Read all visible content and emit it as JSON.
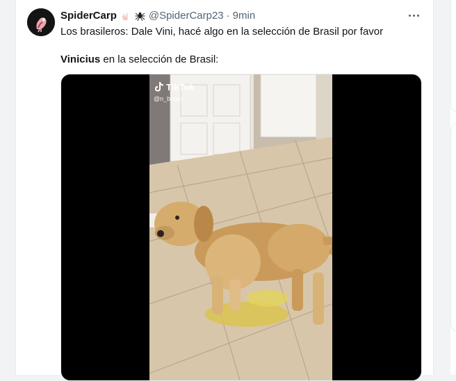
{
  "tweet": {
    "display_name": "SpiderCarp",
    "emojis": [
      "rock-hand-emoji",
      "spider-emoji"
    ],
    "handle": "@SpiderCarp23",
    "separator": "·",
    "time": "9min",
    "line1": "Los brasileros: Dale Vini, hacé algo en la selección de Brasil por favor",
    "line2_bold": "Vinicius",
    "line2_rest": " en la selección de Brasil:"
  },
  "video": {
    "watermark_brand": "TikTok",
    "watermark_user": "@n_butao",
    "icon": "tiktok-icon"
  },
  "colors": {
    "text_primary": "#0f1419",
    "text_secondary": "#536471",
    "media_background": "#000000"
  }
}
